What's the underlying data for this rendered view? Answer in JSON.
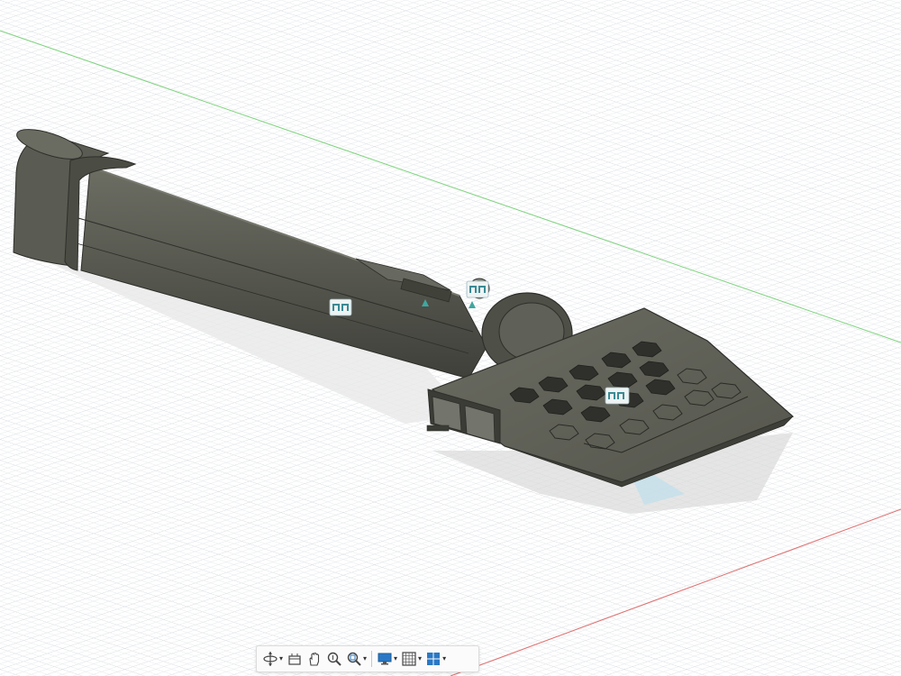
{
  "viewport": {
    "background": "#ffffff",
    "grid_color": "#d9dde1",
    "x_axis_color": "#e05a5a",
    "y_axis_color": "#5ec95e",
    "model_color": "#54554c"
  },
  "nav_toolbar": {
    "items": [
      {
        "name": "orbit",
        "icon": "orbit-icon",
        "has_dropdown": true
      },
      {
        "name": "look-at",
        "icon": "look-at-icon",
        "has_dropdown": false
      },
      {
        "name": "pan",
        "icon": "pan-hand-icon",
        "has_dropdown": false
      },
      {
        "name": "zoom",
        "icon": "zoom-icon",
        "has_dropdown": false
      },
      {
        "name": "fit",
        "icon": "zoom-window-icon",
        "has_dropdown": true
      },
      {
        "name": "display-settings",
        "icon": "display-monitor-icon",
        "has_dropdown": true
      },
      {
        "name": "grid-and-snaps",
        "icon": "grid-icon",
        "has_dropdown": true
      },
      {
        "name": "viewports",
        "icon": "viewports-icon",
        "has_dropdown": true
      }
    ],
    "caret": "▾"
  }
}
